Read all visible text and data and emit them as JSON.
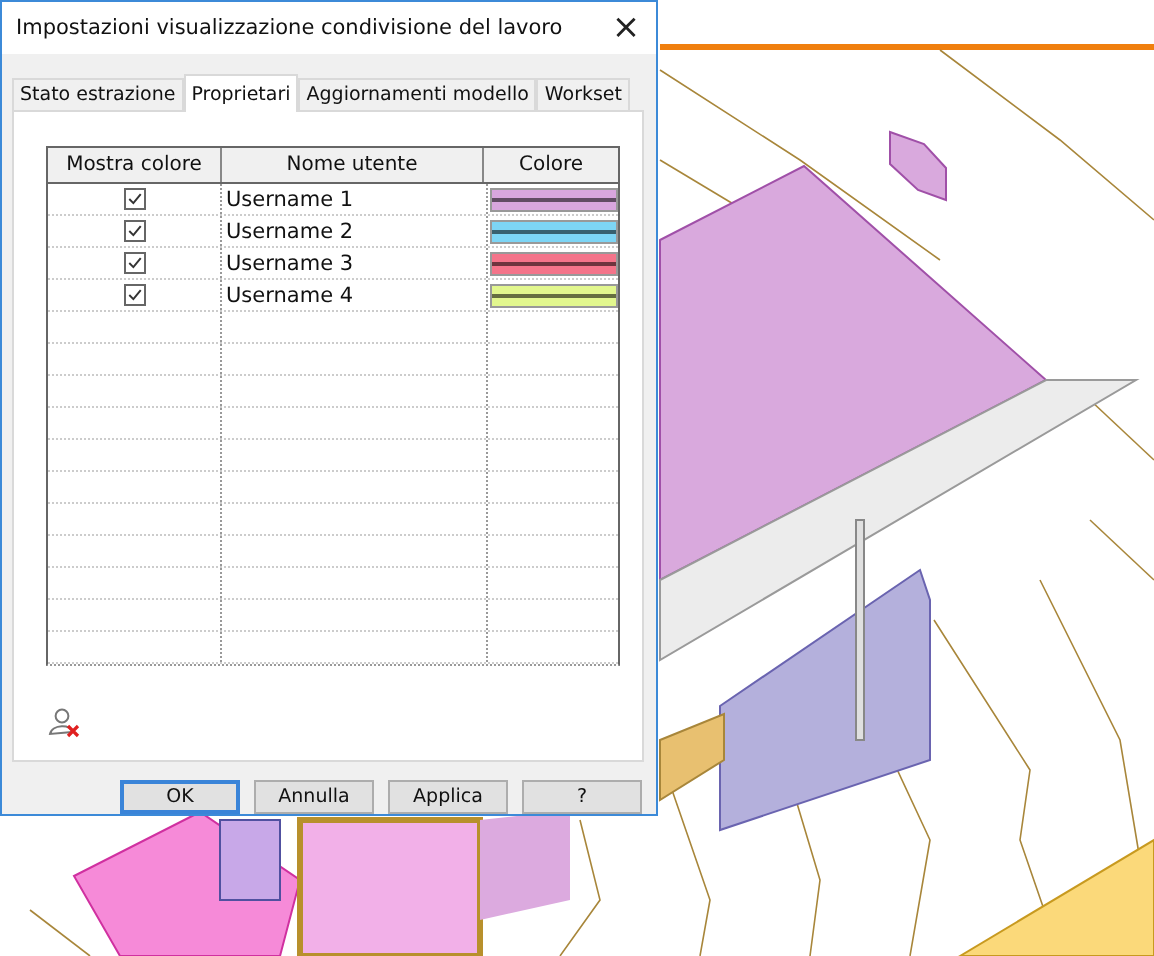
{
  "dialog": {
    "title": "Impostazioni visualizzazione condivisione del lavoro",
    "close": "×"
  },
  "tabs": [
    {
      "label": "Stato estrazione",
      "selected": false
    },
    {
      "label": "Proprietari",
      "selected": true
    },
    {
      "label": "Aggiornamenti modello",
      "selected": false
    },
    {
      "label": "Workset",
      "selected": false
    }
  ],
  "table": {
    "columns": [
      "Mostra colore",
      "Nome utente",
      "Colore"
    ],
    "rows": [
      {
        "checked": true,
        "name": "Username 1",
        "color": "#d9a6de"
      },
      {
        "checked": true,
        "name": "Username 2",
        "color": "#7dd5f5"
      },
      {
        "checked": true,
        "name": "Username 3",
        "color": "#f4748a"
      },
      {
        "checked": true,
        "name": "Username 4",
        "color": "#e2f78e"
      }
    ]
  },
  "buttons": [
    {
      "label": "OK",
      "default": true
    },
    {
      "label": "Annulla",
      "default": false
    },
    {
      "label": "Applica",
      "default": false
    },
    {
      "label": "?",
      "default": false
    }
  ]
}
